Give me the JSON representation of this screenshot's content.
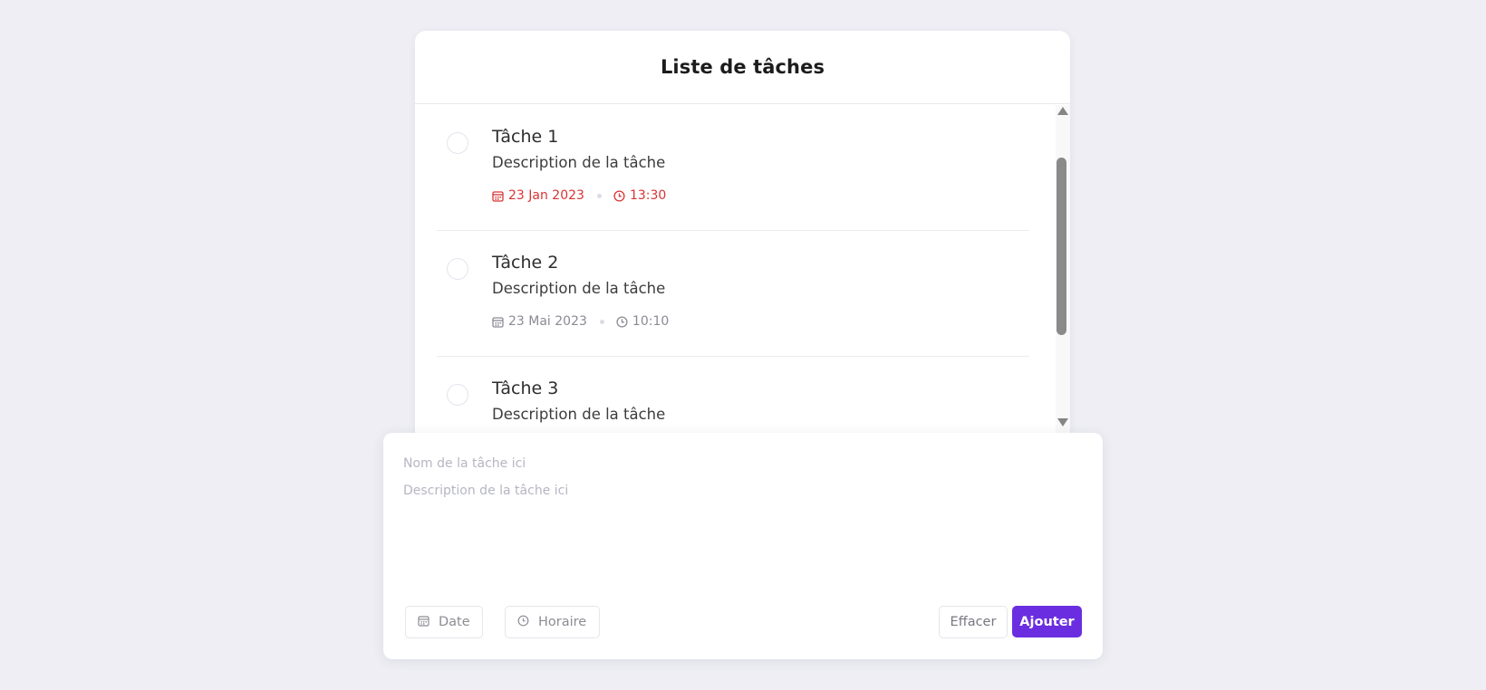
{
  "header": {
    "title": "Liste de tâches"
  },
  "tasks": [
    {
      "title": "Tâche 1",
      "description": "Description de la tâche",
      "date": "23 Jan 2023",
      "time": "13:30",
      "status": "overdue"
    },
    {
      "title": "Tâche 2",
      "description": "Description de la tâche",
      "date": "23 Mai 2023",
      "time": "10:10",
      "status": "normal"
    },
    {
      "title": "Tâche 3",
      "description": "Description de la tâche",
      "date": "",
      "time": "",
      "status": "normal"
    }
  ],
  "form": {
    "name_placeholder": "Nom de la tâche ici",
    "description_placeholder": "Description de la tâche ici",
    "date_label": "Date",
    "time_label": "Horaire",
    "clear_label": "Effacer",
    "add_label": "Ajouter"
  },
  "colors": {
    "accent": "#6a2ee0",
    "overdue": "#d93434",
    "background": "#eeeef4"
  },
  "icons": {
    "date": "calendar-icon",
    "time": "clock-icon"
  }
}
